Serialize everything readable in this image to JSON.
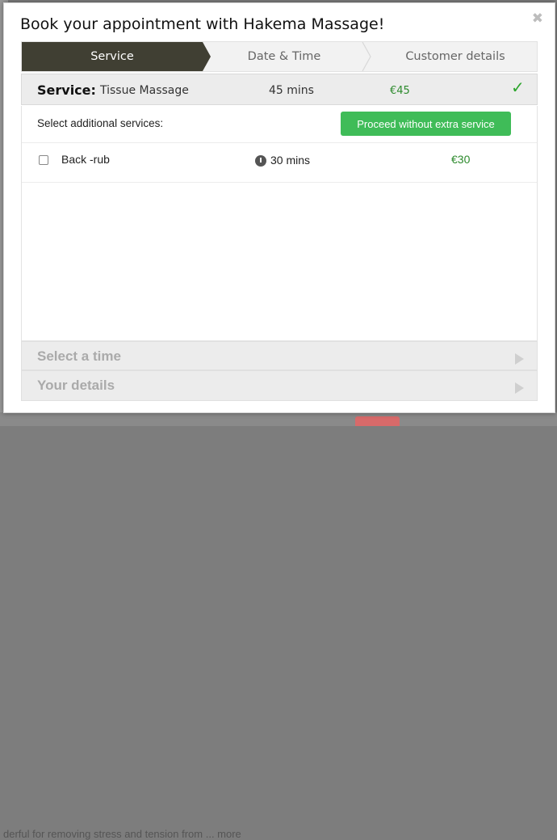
{
  "background": {
    "bottom_text": "derful for removing stress and tension from ... more"
  },
  "modal": {
    "title": "Book your appointment with Hakema Massage!",
    "close_symbol": "✖"
  },
  "steps": [
    {
      "label": "Service",
      "active": true
    },
    {
      "label": "Date & Time",
      "active": false
    },
    {
      "label": "Customer details",
      "active": false
    }
  ],
  "service": {
    "label": "Service:",
    "name": "Tissue Massage",
    "duration": "45 mins",
    "price": "€45",
    "check_symbol": "✓"
  },
  "additional": {
    "label": "Select additional services:",
    "proceed_label": "Proceed without extra service",
    "items": [
      {
        "name": "Back -rub",
        "duration": "30 mins",
        "price": "€30",
        "checked": false
      }
    ]
  },
  "accordion": [
    {
      "label": "Select a time"
    },
    {
      "label": "Your details"
    }
  ],
  "colors": {
    "active_step": "#403f33",
    "accent_green": "#3fbc58",
    "price_green": "#2c8a2c"
  }
}
